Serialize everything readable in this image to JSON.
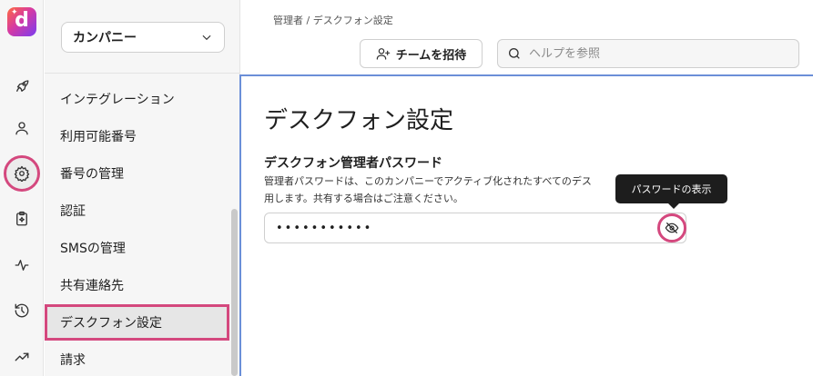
{
  "app": {
    "logo_letter": "d"
  },
  "rail": {
    "items": [
      {
        "icon": "rocket-icon"
      },
      {
        "icon": "user-icon"
      },
      {
        "icon": "gear-icon",
        "active": true
      },
      {
        "icon": "clipboard-sparkle-icon"
      },
      {
        "icon": "activity-icon"
      },
      {
        "icon": "history-icon"
      },
      {
        "icon": "trending-up-icon"
      }
    ]
  },
  "company_select": {
    "label": "カンパニー"
  },
  "subnav": {
    "items": [
      {
        "label": "インテグレーション"
      },
      {
        "label": "利用可能番号"
      },
      {
        "label": "番号の管理"
      },
      {
        "label": "認証"
      },
      {
        "label": "SMSの管理"
      },
      {
        "label": "共有連絡先"
      },
      {
        "label": "デスクフォン設定",
        "selected": true
      },
      {
        "label": "請求"
      }
    ]
  },
  "header": {
    "breadcrumb": "管理者 / デスクフォン設定",
    "invite_label": "チームを招待",
    "search_placeholder": "ヘルプを参照"
  },
  "main": {
    "title": "デスクフォン設定",
    "section_label": "デスクフォン管理者パスワード",
    "section_desc_line1": "管理者パスワードは、このカンパニーでアクティブ化されたすべてのデス",
    "section_desc_line2": "用します。共有する場合はご注意ください。",
    "password_masked": "•••••••••••",
    "tooltip": "パスワードの表示"
  },
  "colors": {
    "highlight": "#d4487e",
    "focus_border": "#6b8fd8"
  }
}
